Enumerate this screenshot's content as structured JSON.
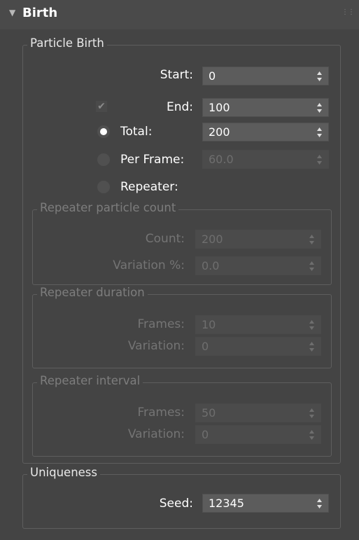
{
  "rollout": {
    "title": "Birth"
  },
  "particle_birth": {
    "title": "Particle Birth",
    "start": {
      "label": "Start:",
      "value": "0"
    },
    "end": {
      "label": "End:",
      "value": "100",
      "checked": true
    },
    "total": {
      "label": "Total:",
      "value": "200",
      "selected": true
    },
    "per_frame": {
      "label": "Per Frame:",
      "value": "60.0",
      "selected": false
    },
    "repeater": {
      "label": "Repeater:",
      "selected": false
    },
    "repeater_particle_count": {
      "title": "Repeater particle count",
      "count": {
        "label": "Count:",
        "value": "200"
      },
      "variation": {
        "label": "Variation %:",
        "value": "0.0"
      }
    },
    "repeater_duration": {
      "title": "Repeater duration",
      "frames": {
        "label": "Frames:",
        "value": "10"
      },
      "variation": {
        "label": "Variation:",
        "value": "0"
      }
    },
    "repeater_interval": {
      "title": "Repeater interval",
      "frames": {
        "label": "Frames:",
        "value": "50"
      },
      "variation": {
        "label": "Variation:",
        "value": "0"
      }
    }
  },
  "uniqueness": {
    "title": "Uniqueness",
    "seed": {
      "label": "Seed:",
      "value": "12345"
    }
  }
}
